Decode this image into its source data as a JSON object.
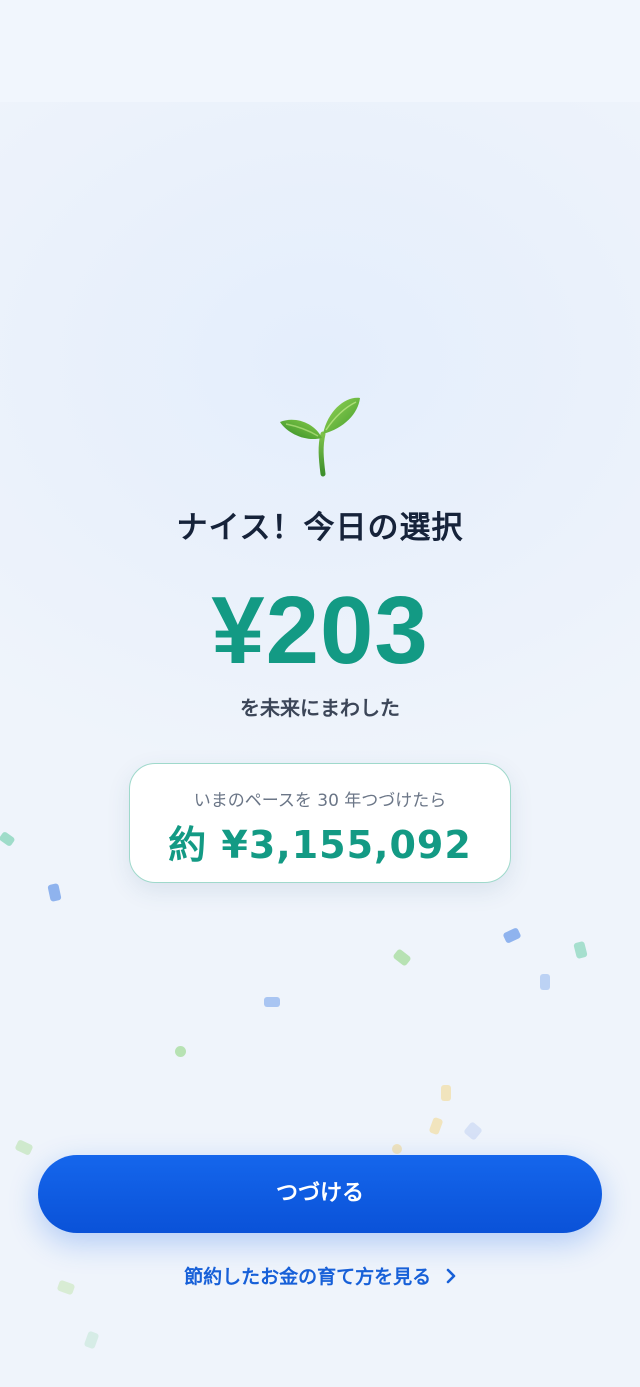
{
  "result": {
    "headline": "ナイス！今日の選択",
    "amount": "¥203",
    "subtext": "を未来にまわした"
  },
  "projection": {
    "label": "いまのペースを 30 年つづけたら",
    "value": "約 ¥3,155,092"
  },
  "actions": {
    "continue_label": "つづける",
    "learn_more_label": "節約したお金の育て方を見る"
  },
  "icons": {
    "sprout": "seedling-icon",
    "chevron": "chevron-right-icon"
  },
  "colors": {
    "accent_green": "#139a84",
    "primary_blue": "#1566ec",
    "link_blue": "#1760d8"
  }
}
